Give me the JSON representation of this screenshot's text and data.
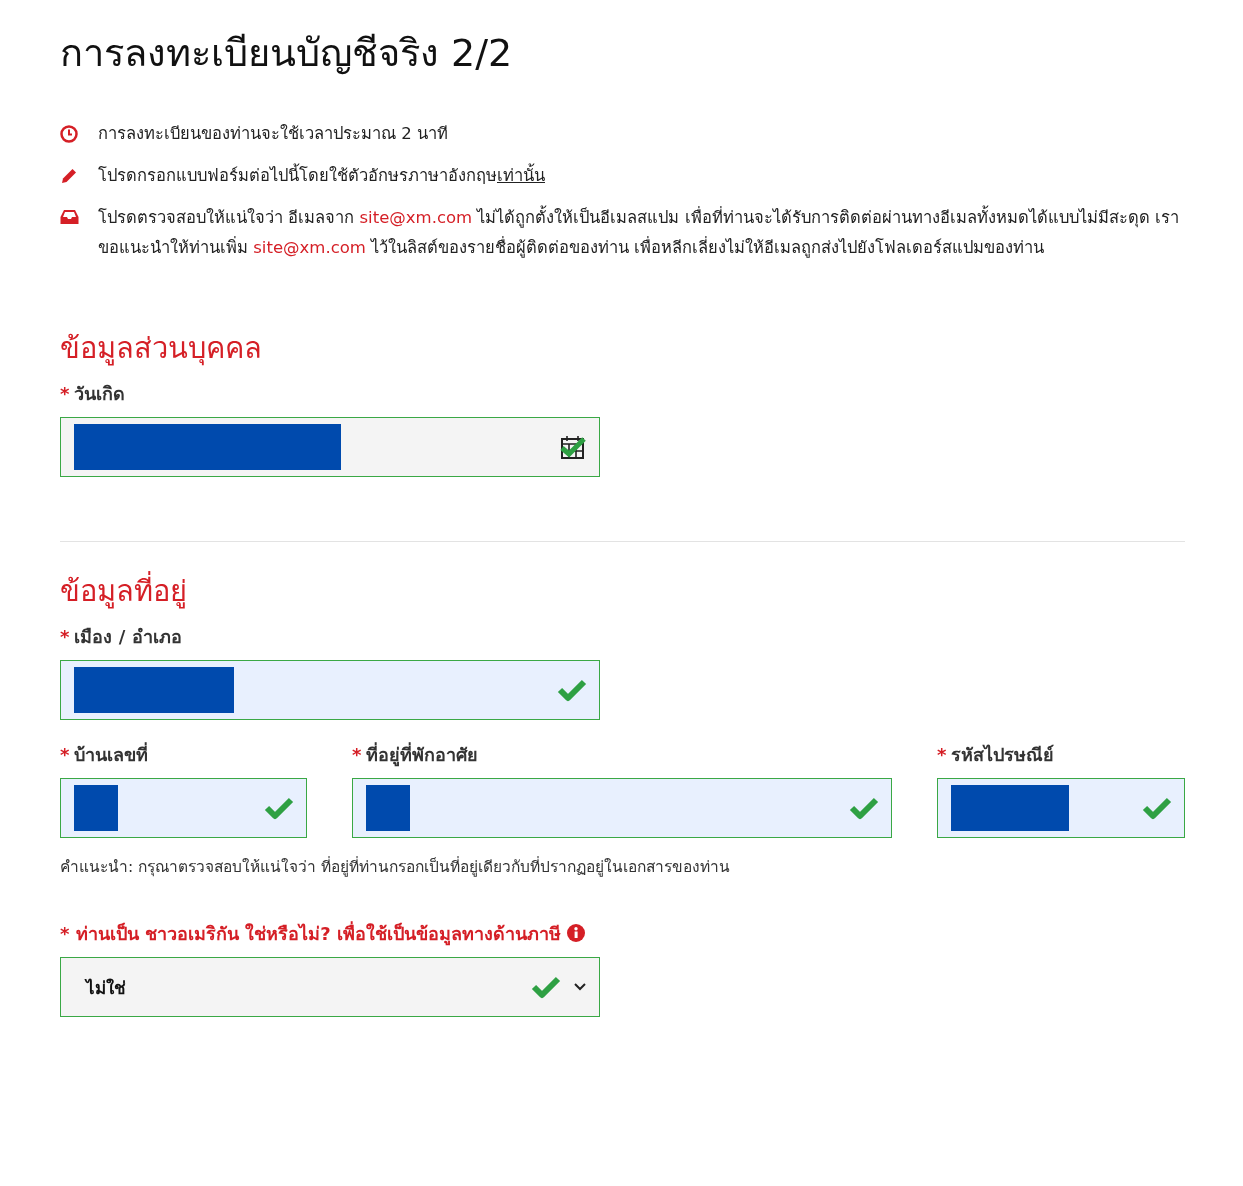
{
  "title": "การลงทะเบียนบัญชีจริง 2/2",
  "notices": [
    {
      "kind": "clock",
      "parts": [
        {
          "kind": "plain",
          "text": "การลงทะเบียนของท่านจะใช้เวลาประมาณ 2 นาที"
        }
      ]
    },
    {
      "kind": "pencil",
      "parts": [
        {
          "kind": "plain",
          "text": "โปรดกรอกแบบฟอร์มต่อไปนี้โดยใช้ตัวอักษรภาษาอังกฤษ"
        },
        {
          "kind": "underline",
          "text": "เท่านั้น"
        }
      ]
    },
    {
      "kind": "inbox",
      "parts": [
        {
          "kind": "plain",
          "text": "โปรดตรวจสอบให้แน่ใจว่า อีเมลจาก "
        },
        {
          "kind": "email",
          "text": "site@xm.com"
        },
        {
          "kind": "plain",
          "text": " ไม่ได้ถูกตั้งให้เป็นอีเมลสแปม เพื่อที่ท่านจะได้รับการติดต่อผ่านทางอีเมลทั้งหมดได้แบบไม่มีสะดุด เราขอแนะนำให้ท่านเพิ่ม "
        },
        {
          "kind": "email",
          "text": "site@xm.com"
        },
        {
          "kind": "plain",
          "text": " ไว้ในลิสต์ของรายชื่อผู้ติดต่อของท่าน เพื่อหลีกเลี่ยงไม่ให้อีเมลถูกส่งไปยังโฟลเดอร์สแปมของท่าน"
        }
      ]
    }
  ],
  "sections": [
    {
      "heading": "ข้อมูลส่วนบุคคล",
      "rows": [
        [
          {
            "kind": "date",
            "mark": "*",
            "label": "วันเกิด",
            "valid": true,
            "autofilled": false,
            "redacted": true
          }
        ]
      ]
    },
    {
      "heading": "ข้อมูลที่อยู่",
      "rows": [
        [
          {
            "kind": "text",
            "mark": "*",
            "label": "เมือง / อำเภอ",
            "valid": true,
            "autofilled": true,
            "redacted": true
          }
        ],
        [
          {
            "kind": "text",
            "mark": "*",
            "label": "บ้านเลขที่",
            "valid": true,
            "autofilled": true,
            "redacted": true
          },
          {
            "kind": "text",
            "mark": "*",
            "label": "ที่อยู่ที่พักอาศัย",
            "valid": true,
            "autofilled": true,
            "redacted": true
          },
          {
            "kind": "text",
            "mark": "*",
            "label": "รหัสไปรษณีย์",
            "valid": true,
            "autofilled": true,
            "redacted": true
          }
        ]
      ],
      "hint": "คำแนะนำ: กรุณาตรวจสอบให้แน่ใจว่า ที่อยู่ที่ท่านกรอกเป็นที่อยู่เดียวกับที่ปรากฏอยู่ในเอกสารของท่าน",
      "question": {
        "mark": "*",
        "label": "ท่านเป็น ชาวอเมริกัน ใช่หรือไม่? เพื่อใช้เป็นข้อมูลทางด้านภาษี",
        "info": true,
        "kind": "select",
        "value": "ไม่ใช่",
        "valid": true,
        "autofilled": false
      }
    }
  ]
}
